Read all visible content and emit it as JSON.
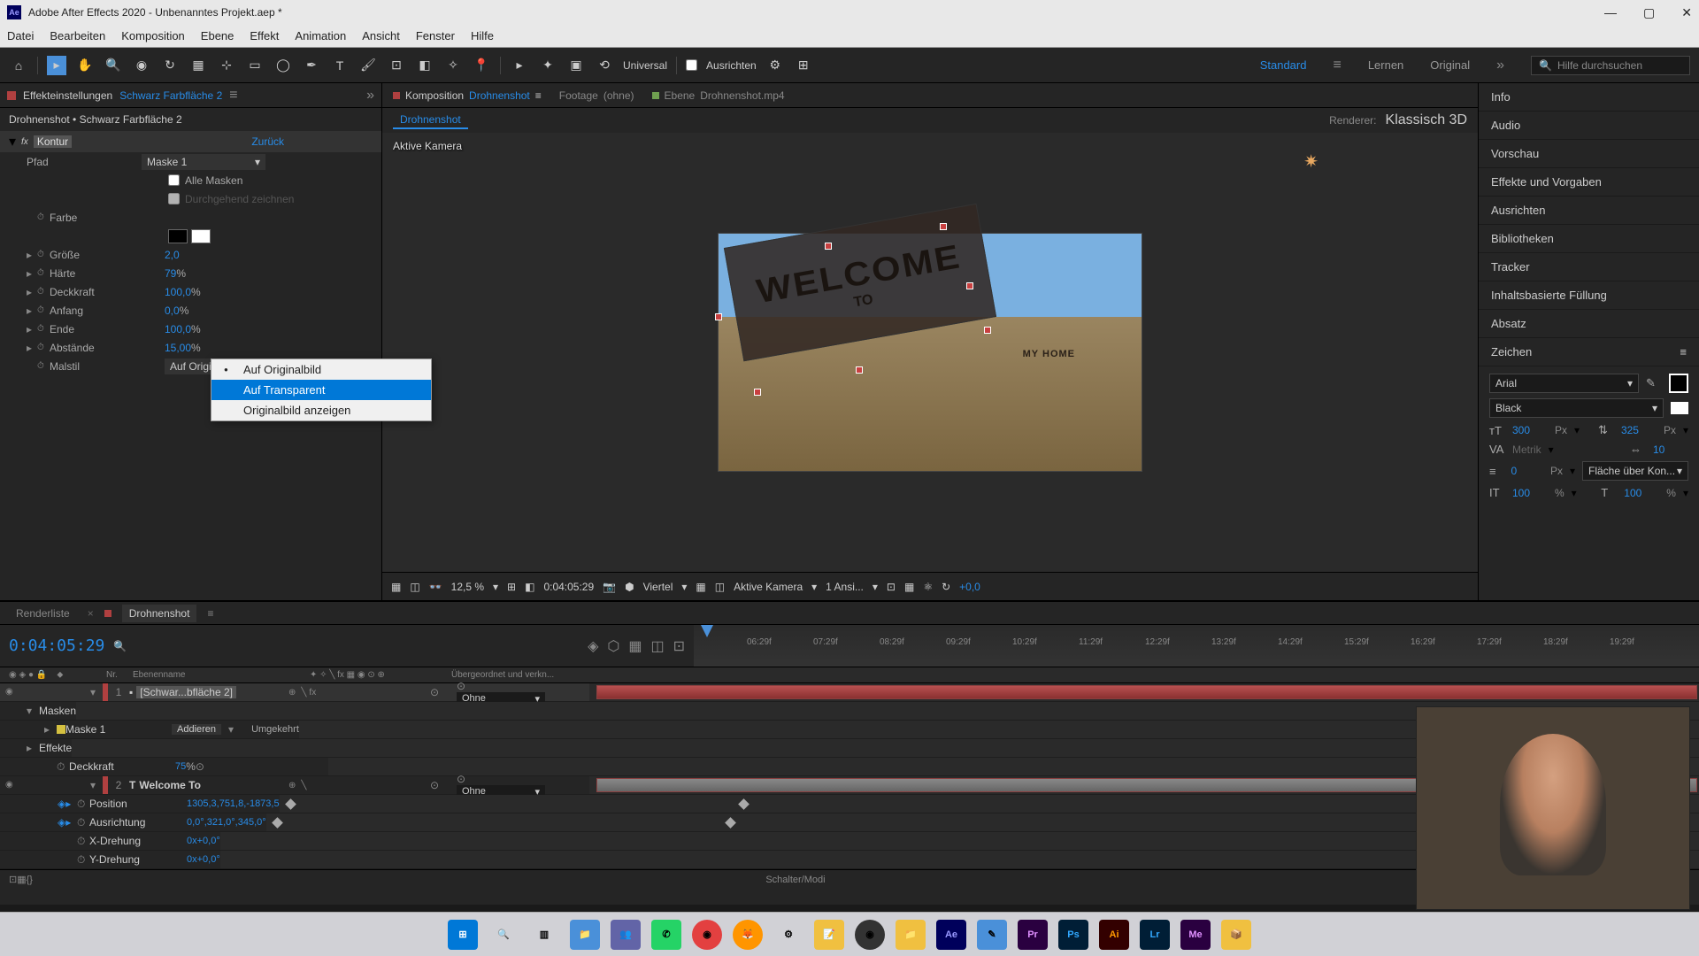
{
  "titlebar": {
    "title": "Adobe After Effects 2020 - Unbenanntes Projekt.aep *"
  },
  "menubar": [
    "Datei",
    "Bearbeiten",
    "Komposition",
    "Ebene",
    "Effekt",
    "Animation",
    "Ansicht",
    "Fenster",
    "Hilfe"
  ],
  "toolbar": {
    "snap_label": "Universal",
    "align_label": "Ausrichten",
    "workspace_active": "Standard",
    "workspace_2": "Lernen",
    "workspace_3": "Original",
    "search_placeholder": "Hilfe durchsuchen"
  },
  "effects_panel": {
    "tab_label": "Effekteinstellungen",
    "tab_layer": "Schwarz Farbfläche 2",
    "breadcrumb": "Drohnenshot • Schwarz Farbfläche 2",
    "effect_name": "Kontur",
    "reset": "Zurück",
    "props": {
      "pfad": "Pfad",
      "pfad_val": "Maske 1",
      "alle_masken": "Alle Masken",
      "durchgehend": "Durchgehend zeichnen",
      "farbe": "Farbe",
      "groesse": "Größe",
      "groesse_val": "2,0",
      "haerte": "Härte",
      "haerte_val": "79",
      "haerte_unit": "%",
      "deckkraft": "Deckkraft",
      "deckkraft_val": "100,0",
      "deckkraft_unit": "%",
      "anfang": "Anfang",
      "anfang_val": "0,0",
      "anfang_unit": "%",
      "ende": "Ende",
      "ende_val": "100,0",
      "ende_unit": "%",
      "abstaende": "Abstände",
      "abstaende_val": "15,00",
      "abstaende_unit": "%",
      "malstil": "Malstil",
      "malstil_val": "Auf Originalbild"
    },
    "dropdown": {
      "opt1": "Auf Originalbild",
      "opt2": "Auf Transparent",
      "opt3": "Originalbild anzeigen"
    }
  },
  "comp": {
    "tab1_label": "Komposition",
    "tab1_name": "Drohnenshot",
    "tab2_label": "Footage",
    "tab2_name": "(ohne)",
    "tab3_label": "Ebene",
    "tab3_name": "Drohnenshot.mp4",
    "breadcrumb": "Drohnenshot",
    "renderer_label": "Renderer:",
    "renderer_val": "Klassisch 3D",
    "viewer_label": "Aktive Kamera",
    "sign_big": "WELCOME",
    "sign_small": "TO",
    "subtitle": "MY HOME",
    "footer": {
      "zoom": "12,5 %",
      "time": "0:04:05:29",
      "res": "Viertel",
      "view": "Aktive Kamera",
      "views": "1 Ansi...",
      "exposure": "+0,0"
    }
  },
  "right": {
    "panels": [
      "Info",
      "Audio",
      "Vorschau",
      "Effekte und Vorgaben",
      "Ausrichten",
      "Bibliotheken",
      "Tracker",
      "Inhaltsbasierte Füllung",
      "Absatz"
    ],
    "char_title": "Zeichen",
    "font": "Arial",
    "weight": "Black",
    "size": "300",
    "size_unit": "Px",
    "leading": "325",
    "leading_unit": "Px",
    "kerning": "Metrik",
    "tracking": "10",
    "stroke": "0",
    "stroke_unit": "Px",
    "stroke_mode": "Fläche über Kon...",
    "vscale": "100",
    "vscale_unit": "%",
    "hscale": "100",
    "hscale_unit": "%"
  },
  "timeline": {
    "tab1": "Renderliste",
    "tab2": "Drohnenshot",
    "timecode": "0:04:05:29",
    "ruler_ticks": [
      "06:29f",
      "07:29f",
      "08:29f",
      "09:29f",
      "10:29f",
      "11:29f",
      "12:29f",
      "13:29f",
      "14:29f",
      "15:29f",
      "16:29f",
      "17:29f",
      "18:29f",
      "19:29f"
    ],
    "col_nr": "Nr.",
    "col_name": "Ebenenname",
    "col_parent": "Übergeordnet und verkn...",
    "layers": [
      {
        "num": "1",
        "name": "[Schwar...bfläche 2]",
        "parent": "Ohne"
      },
      {
        "num": "2",
        "name": "Welcome To",
        "parent": "Ohne"
      }
    ],
    "sublayers": {
      "masken": "Masken",
      "maske1": "Maske 1",
      "maske1_mode": "Addieren",
      "maske1_inv": "Umgekehrt",
      "effekte": "Effekte",
      "deckkraft": "Deckkraft",
      "deckkraft_val": "75",
      "deckkraft_unit": "%",
      "position": "Position",
      "position_val": "1305,3,751,8,-1873,5",
      "ausrichtung": "Ausrichtung",
      "ausrichtung_val": "0,0°,321,0°,345,0°",
      "xdrehung": "X-Drehung",
      "xdrehung_val": "0x+0,0°",
      "ydrehung": "Y-Drehung",
      "ydrehung_val": "0x+0,0°"
    },
    "footer": "Schalter/Modi"
  },
  "taskbar": {
    "apps": [
      "Win",
      "Search",
      "Tasks",
      "Files",
      "Teams",
      "WA",
      "Br",
      "FF",
      "App",
      "Rec",
      "OBS",
      "Ex",
      "Ae",
      "Edit",
      "Pr",
      "Ps",
      "Ai",
      "Lr",
      "Me",
      "App2"
    ]
  }
}
